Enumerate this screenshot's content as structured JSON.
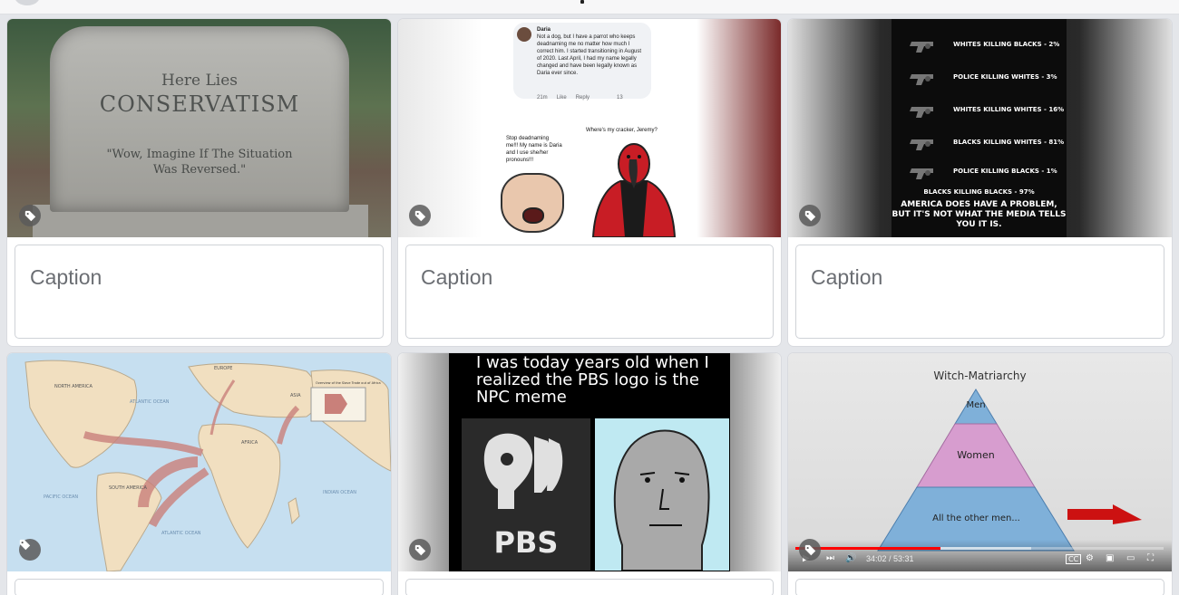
{
  "caption_placeholder": "Caption",
  "cards": [
    {
      "tombstone_line1": "Here Lies",
      "tombstone_line2": "CONSERVATISM",
      "tombstone_line3": "\"Wow, Imagine If The Situation",
      "tombstone_line4": "Was Reversed.\""
    },
    {
      "post_author": "Daria",
      "post_text": "Not a dog, but I have a parrot who keeps deadnaming me no matter how much I correct him. I started transitioning in August of 2020. Last April, I had my name legally changed and have been legally known as Daria ever since.",
      "post_time": "21m",
      "post_like": "Like",
      "post_reply": "Reply",
      "post_reactions": "13",
      "speech_left": "Stop deadnaming me!!! My name is Daria and I use she/her pronouns!!!",
      "speech_right": "Where's my cracker, Jeremy?"
    },
    {
      "rows": [
        "WHITES KILLING BLACKS - 2%",
        "POLICE KILLING WHITES - 3%",
        "WHITES KILLING WHITES - 16%",
        "BLACKS KILLING WHITES - 81%",
        "POLICE KILLING BLACKS - 1%"
      ],
      "bottom_line1": "BLACKS KILLING BLACKS - 97%",
      "bottom_line2": "AMERICA DOES HAVE A PROBLEM, BUT IT'S NOT WHAT THE MEDIA TELLS YOU IT IS."
    },
    {
      "map_labels": [
        "NORTH AMERICA",
        "EUROPE",
        "ASIA",
        "AFRICA",
        "SOUTH AMERICA",
        "ATLANTIC OCEAN",
        "PACIFIC OCEAN",
        "INDIAN OCEAN",
        "ATLANTIC OCEAN"
      ],
      "legend_title": "Overview of the Slave Trade out of Africa"
    },
    {
      "headline": "I was today years old when I realized the PBS logo is the NPC meme",
      "logo_text": "PBS"
    },
    {
      "pyramid_title": "Witch-Matriarchy",
      "tier_top": "Men",
      "tier_mid": "Women",
      "tier_bottom": "All the other men...",
      "player_time": "34:02 / 53:31",
      "arrow_color": "#cc1111",
      "progress_fraction": 0.39
    }
  ],
  "icons": {
    "tag": "tag-icon",
    "play": "play-icon",
    "next": "next-icon",
    "volume": "volume-icon",
    "cc": "cc-icon",
    "settings": "gear-icon",
    "miniplayer": "miniplayer-icon",
    "theater": "theater-icon",
    "fullscreen": "fullscreen-icon"
  },
  "colors": {
    "background": "#e4e6ea",
    "card": "#ffffff",
    "caption_text": "#6b6e73",
    "youtube_red": "#ff0000"
  }
}
